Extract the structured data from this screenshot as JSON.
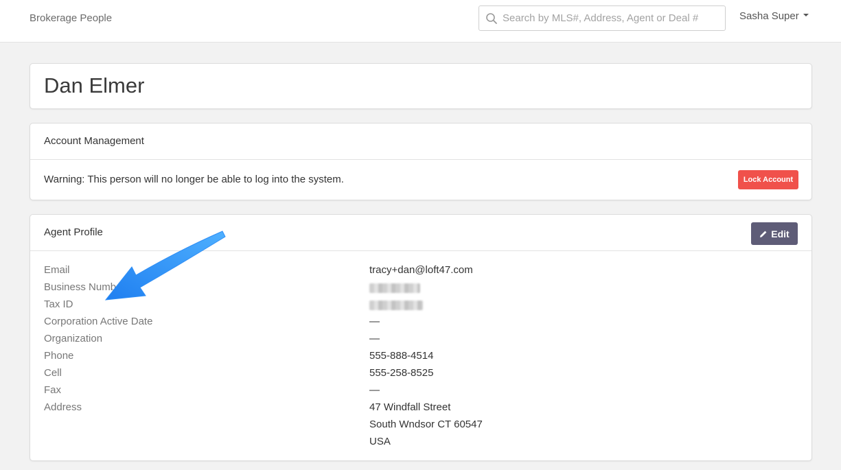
{
  "nav": {
    "brand": "Brokerage People",
    "search_placeholder": "Search by MLS#, Address, Agent or Deal #",
    "user_name": "Sasha Super"
  },
  "person": {
    "name": "Dan Elmer"
  },
  "account": {
    "title": "Account Management",
    "warning": "Warning: This person will no longer be able to log into the system.",
    "lock_label": "Lock Account",
    "lock_color": "#f0514b"
  },
  "profile": {
    "title": "Agent Profile",
    "edit_label": "Edit",
    "edit_color": "#5e5c77",
    "fields": {
      "email": {
        "label": "Email",
        "value": "tracy+dan@loft47.com"
      },
      "business_number": {
        "label": "Business Number"
      },
      "tax_id": {
        "label": "Tax ID"
      },
      "corporation_active_date": {
        "label": "Corporation Active Date",
        "value": "—"
      },
      "organization": {
        "label": "Organization",
        "value": "—"
      },
      "phone": {
        "label": "Phone",
        "value": "555-888-4514"
      },
      "cell": {
        "label": "Cell",
        "value": "555-258-8525"
      },
      "fax": {
        "label": "Fax",
        "value": "—"
      },
      "address": {
        "label": "Address",
        "line1": "47 Windfall Street",
        "line2": "South Wndsor CT 60547",
        "line3": "USA"
      }
    }
  },
  "annotation": {
    "arrow_color": "#2f8ef5"
  }
}
